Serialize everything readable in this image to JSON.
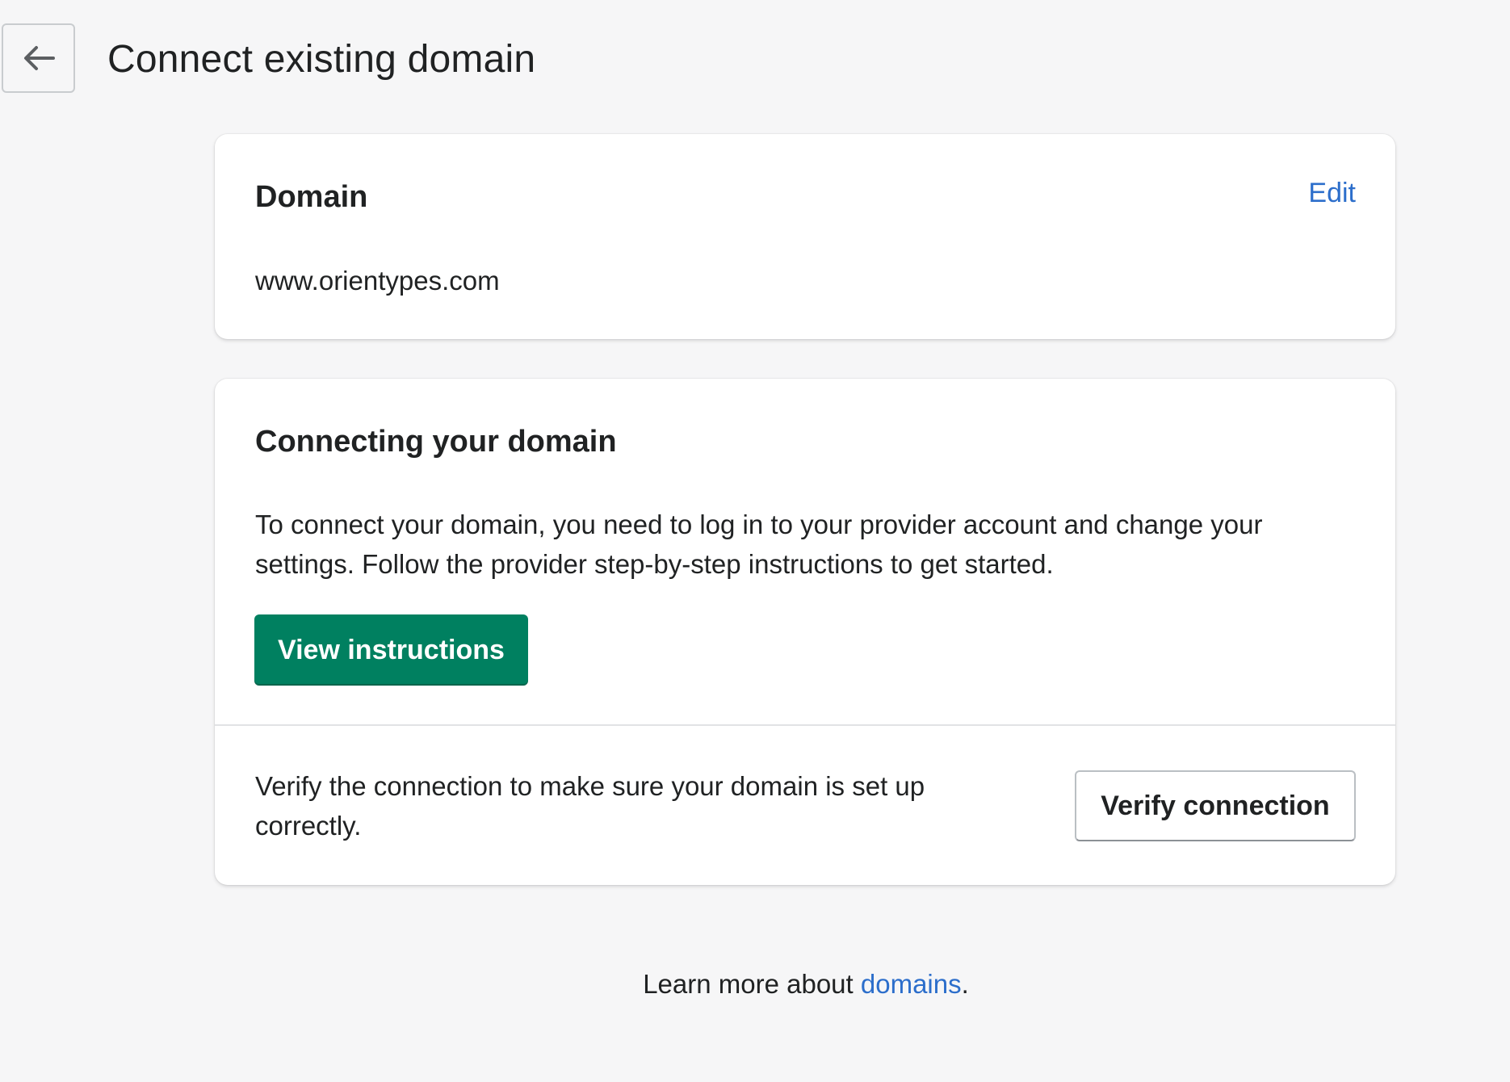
{
  "header": {
    "back_icon": "arrow-left-icon",
    "title": "Connect existing domain"
  },
  "domain_card": {
    "heading": "Domain",
    "edit_label": "Edit",
    "domain_value": "www.orientypes.com"
  },
  "connect_card": {
    "heading": "Connecting your domain",
    "description": "To connect your domain, you need to log in to your provider account and change your settings. Follow the provider step-by-step instructions to get started.",
    "view_instructions_label": "View instructions",
    "verify_description": "Verify the connection to make sure your domain is set up correctly.",
    "verify_label": "Verify connection"
  },
  "footer": {
    "prefix": "Learn more about ",
    "link_label": "domains",
    "suffix": "."
  },
  "colors": {
    "background": "#f6f6f7",
    "primary": "#008060",
    "link": "#2c6ecb",
    "text": "#202223"
  }
}
